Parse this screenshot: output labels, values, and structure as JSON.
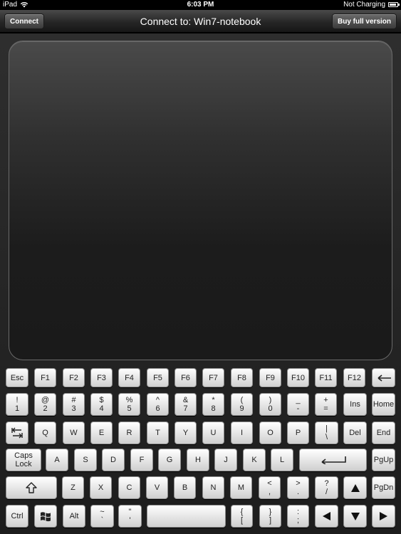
{
  "status_bar": {
    "device": "iPad",
    "time": "6:03 PM",
    "battery_status": "Not Charging"
  },
  "nav": {
    "connect_label": "Connect",
    "title": "Connect to: Win7-notebook",
    "buy_label": "Buy full version"
  },
  "keyboard": {
    "rows": [
      [
        {
          "name": "key-esc",
          "lines": [
            "Esc"
          ]
        },
        {
          "name": "key-f1",
          "lines": [
            "F1"
          ]
        },
        {
          "name": "key-f2",
          "lines": [
            "F2"
          ]
        },
        {
          "name": "key-f3",
          "lines": [
            "F3"
          ]
        },
        {
          "name": "key-f4",
          "lines": [
            "F4"
          ]
        },
        {
          "name": "key-f5",
          "lines": [
            "F5"
          ]
        },
        {
          "name": "key-f6",
          "lines": [
            "F6"
          ]
        },
        {
          "name": "key-f7",
          "lines": [
            "F7"
          ]
        },
        {
          "name": "key-f8",
          "lines": [
            "F8"
          ]
        },
        {
          "name": "key-f9",
          "lines": [
            "F9"
          ]
        },
        {
          "name": "key-f10",
          "lines": [
            "F10"
          ]
        },
        {
          "name": "key-f11",
          "lines": [
            "F11"
          ]
        },
        {
          "name": "key-f12",
          "lines": [
            "F12"
          ]
        },
        {
          "name": "backspace-key",
          "icon": "backspace-arrow-icon"
        }
      ],
      [
        {
          "name": "key-1",
          "lines": [
            "!",
            "1"
          ]
        },
        {
          "name": "key-2",
          "lines": [
            "@",
            "2"
          ]
        },
        {
          "name": "key-3",
          "lines": [
            "#",
            "3"
          ]
        },
        {
          "name": "key-4",
          "lines": [
            "$",
            "4"
          ]
        },
        {
          "name": "key-5",
          "lines": [
            "%",
            "5"
          ]
        },
        {
          "name": "key-6",
          "lines": [
            "^",
            "6"
          ]
        },
        {
          "name": "key-7",
          "lines": [
            "&",
            "7"
          ]
        },
        {
          "name": "key-8",
          "lines": [
            "*",
            "8"
          ]
        },
        {
          "name": "key-9",
          "lines": [
            "(",
            "9"
          ]
        },
        {
          "name": "key-0",
          "lines": [
            ")",
            "0"
          ]
        },
        {
          "name": "key-minus",
          "lines": [
            "_",
            "-"
          ]
        },
        {
          "name": "key-equals",
          "lines": [
            "+",
            "="
          ]
        },
        {
          "name": "key-ins",
          "lines": [
            "Ins"
          ]
        },
        {
          "name": "key-home",
          "lines": [
            "Home"
          ]
        }
      ],
      [
        {
          "name": "tab-key",
          "icon": "tab-arrows-icon"
        },
        {
          "name": "key-q",
          "lines": [
            "Q"
          ]
        },
        {
          "name": "key-w",
          "lines": [
            "W"
          ]
        },
        {
          "name": "key-e",
          "lines": [
            "E"
          ]
        },
        {
          "name": "key-r",
          "lines": [
            "R"
          ]
        },
        {
          "name": "key-t",
          "lines": [
            "T"
          ]
        },
        {
          "name": "key-y",
          "lines": [
            "Y"
          ]
        },
        {
          "name": "key-u",
          "lines": [
            "U"
          ]
        },
        {
          "name": "key-i",
          "lines": [
            "I"
          ]
        },
        {
          "name": "key-o",
          "lines": [
            "O"
          ]
        },
        {
          "name": "key-p",
          "lines": [
            "P"
          ]
        },
        {
          "name": "key-backslash",
          "lines": [
            "|",
            "\\"
          ]
        },
        {
          "name": "key-del",
          "lines": [
            "Del"
          ]
        },
        {
          "name": "key-end",
          "lines": [
            "End"
          ]
        }
      ],
      [
        {
          "name": "key-caps-lock",
          "lines": [
            "Caps",
            "Lock"
          ]
        },
        {
          "name": "key-a",
          "lines": [
            "A"
          ]
        },
        {
          "name": "key-s",
          "lines": [
            "S"
          ]
        },
        {
          "name": "key-d",
          "lines": [
            "D"
          ]
        },
        {
          "name": "key-f",
          "lines": [
            "F"
          ]
        },
        {
          "name": "key-g",
          "lines": [
            "G"
          ]
        },
        {
          "name": "key-h",
          "lines": [
            "H"
          ]
        },
        {
          "name": "key-j",
          "lines": [
            "J"
          ]
        },
        {
          "name": "key-k",
          "lines": [
            "K"
          ]
        },
        {
          "name": "key-l",
          "lines": [
            "L"
          ]
        },
        {
          "name": "enter-key",
          "icon": "enter-arrow-icon"
        },
        {
          "name": "key-pgup",
          "lines": [
            "PgUp"
          ]
        }
      ],
      [
        {
          "name": "shift-key",
          "icon": "shift-arrow-icon"
        },
        {
          "name": "key-z",
          "lines": [
            "Z"
          ]
        },
        {
          "name": "key-x",
          "lines": [
            "X"
          ]
        },
        {
          "name": "key-c",
          "lines": [
            "C"
          ]
        },
        {
          "name": "key-v",
          "lines": [
            "V"
          ]
        },
        {
          "name": "key-b",
          "lines": [
            "B"
          ]
        },
        {
          "name": "key-n",
          "lines": [
            "N"
          ]
        },
        {
          "name": "key-m",
          "lines": [
            "M"
          ]
        },
        {
          "name": "key-comma",
          "lines": [
            "<",
            ","
          ]
        },
        {
          "name": "key-period",
          "lines": [
            ">",
            "."
          ]
        },
        {
          "name": "key-slash",
          "lines": [
            "?",
            "/"
          ]
        },
        {
          "name": "arrow-up-key",
          "icon": "arrow-up-icon"
        },
        {
          "name": "key-pgdn",
          "lines": [
            "PgDn"
          ]
        }
      ],
      [
        {
          "name": "key-ctrl",
          "lines": [
            "Ctrl"
          ]
        },
        {
          "name": "windows-key",
          "icon": "windows-logo-icon"
        },
        {
          "name": "key-alt",
          "lines": [
            "Alt"
          ]
        },
        {
          "name": "key-backtick",
          "lines": [
            "~",
            "`"
          ]
        },
        {
          "name": "key-quote",
          "lines": [
            "\"",
            "'"
          ]
        },
        {
          "name": "space-key",
          "lines": []
        },
        {
          "name": "key-open-bracket",
          "lines": [
            "{",
            "["
          ]
        },
        {
          "name": "key-close-bracket",
          "lines": [
            "}",
            "]"
          ]
        },
        {
          "name": "key-semicolon",
          "lines": [
            ":",
            ";"
          ]
        },
        {
          "name": "arrow-left-key",
          "icon": "arrow-left-icon"
        },
        {
          "name": "arrow-down-key",
          "icon": "arrow-down-icon"
        },
        {
          "name": "arrow-right-key",
          "icon": "arrow-right-icon"
        }
      ]
    ]
  }
}
